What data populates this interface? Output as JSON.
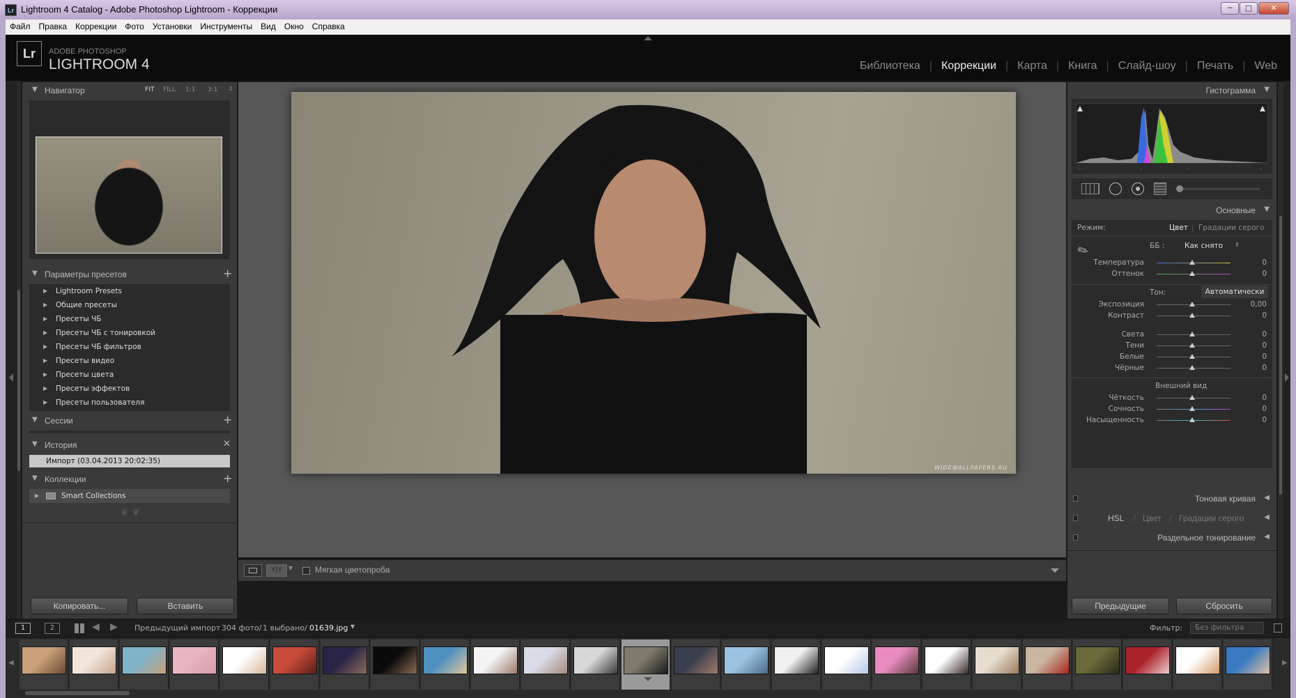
{
  "window": {
    "title": "Lightroom 4 Catalog - Adobe Photoshop Lightroom - Коррекции",
    "app_icon": "Lr",
    "controls": {
      "minimize": "─",
      "maximize": "□",
      "close": "✕"
    }
  },
  "menu": [
    "Файл",
    "Правка",
    "Коррекции",
    "Фото",
    "Установки",
    "Инструменты",
    "Вид",
    "Окно",
    "Справка"
  ],
  "identity": {
    "icon": "Lr",
    "line1": "ADOBE PHOTOSHOP",
    "line2": "LIGHTROOM 4"
  },
  "modules": [
    {
      "label": "Библиотека"
    },
    {
      "label": "Коррекции",
      "active": true
    },
    {
      "label": "Карта"
    },
    {
      "label": "Книга"
    },
    {
      "label": "Слайд-шоу"
    },
    {
      "label": "Печать"
    },
    {
      "label": "Web"
    }
  ],
  "navigator": {
    "title": "Навигатор",
    "zoom": {
      "fit": "FIT",
      "fill": "FILL",
      "one": "1:1",
      "three": "3:1"
    }
  },
  "presets": {
    "title": "Параметры пресетов",
    "items": [
      "Lightroom Presets",
      "Общие пресеты",
      "Пресеты ЧБ",
      "Пресеты ЧБ с тонировкой",
      "Пресеты ЧБ фильтров",
      "Пресеты видео",
      "Пресеты цвета",
      "Пресеты эффектов",
      "Пресеты пользователя"
    ]
  },
  "sessions": {
    "title": "Сессии"
  },
  "history": {
    "title": "История",
    "item": "Импорт (03.04.2013 20:02:35)"
  },
  "collections": {
    "title": "Коллекции",
    "item": "Smart Collections"
  },
  "left_buttons": {
    "copy": "Копировать...",
    "paste": "Вставить"
  },
  "toolbar": {
    "softproof": "Мягкая цветопроба",
    "compare": "Y|Y"
  },
  "watermark": "WIDEWALLPAPERS.RU",
  "histogram": {
    "title": "Гистограмма"
  },
  "basic": {
    "title": "Основные",
    "mode_label": "Режим:",
    "mode_color": "Цвет",
    "mode_gray": "Градации серого",
    "wb_label": "ББ :",
    "wb_value": "Как снято",
    "tone_label": "Тон:",
    "auto": "Автоматически",
    "presence_label": "Внешний вид",
    "sliders_wb": [
      {
        "label": "Температура",
        "value": "0"
      },
      {
        "label": "Оттенок",
        "value": "0"
      }
    ],
    "sliders_tone1": [
      {
        "label": "Экспозиция",
        "value": "0,00"
      },
      {
        "label": "Контраст",
        "value": "0"
      }
    ],
    "sliders_tone2": [
      {
        "label": "Света",
        "value": "0"
      },
      {
        "label": "Тени",
        "value": "0"
      },
      {
        "label": "Белые",
        "value": "0"
      },
      {
        "label": "Чёрные",
        "value": "0"
      }
    ],
    "sliders_presence": [
      {
        "label": "Чёткость",
        "value": "0"
      },
      {
        "label": "Сочность",
        "value": "0"
      },
      {
        "label": "Насыщенность",
        "value": "0"
      }
    ]
  },
  "tone_curve": {
    "title": "Тоновая кривая"
  },
  "hsl": {
    "a": "HSL",
    "b": "Цвет",
    "c": "Градации серого"
  },
  "split_toning": {
    "title": "Раздельное тонирование"
  },
  "right_buttons": {
    "previous": "Предыдущие",
    "reset": "Сбросить"
  },
  "filmstrip_bar": {
    "screen1": "1",
    "screen2": "2",
    "source": "Предыдущий импорт",
    "count": "304 фото/",
    "selected": "1 выбрано/",
    "filename": "01639.jpg",
    "filter_label": "Фильтр:",
    "filter_value": "Без фильтра"
  },
  "colors": {
    "bg": "#1a1a1a",
    "panel": "#3a3a3a",
    "center": "#4d4d4d",
    "accent_active": "#eeeeee"
  },
  "thumbnails": [
    {
      "c1": "#c9a07a",
      "c2": "#6b4a33"
    },
    {
      "c1": "#f2e6dc",
      "c2": "#c8a28e"
    },
    {
      "c1": "#7fb3c9",
      "c2": "#c89f7a"
    },
    {
      "c1": "#e8b6c0",
      "c2": "#d99aa8"
    },
    {
      "c1": "#ffffff",
      "c2": "#d7b79a"
    },
    {
      "c1": "#c84b3a",
      "c2": "#5a1e1a"
    },
    {
      "c1": "#2a2446",
      "c2": "#8b6a5a"
    },
    {
      "c1": "#0a0a0a",
      "c2": "#8a6a55"
    },
    {
      "c1": "#4f90c0",
      "c2": "#e3c79a"
    },
    {
      "c1": "#f4f4f4",
      "c2": "#9a7a6a"
    },
    {
      "c1": "#d9dbe6",
      "c2": "#a58a7a"
    },
    {
      "c1": "#d8d8d8",
      "c2": "#3a3a3a"
    },
    {
      "c1": "#7f7a6c",
      "c2": "#1a1a1a"
    },
    {
      "c1": "#3a3f4e",
      "c2": "#a07a66"
    },
    {
      "c1": "#9bc2e0",
      "c2": "#4a6a8a"
    },
    {
      "c1": "#f0f0f0",
      "c2": "#222222"
    },
    {
      "c1": "#ffffff",
      "c2": "#b8c8e8"
    },
    {
      "c1": "#e98bc0",
      "c2": "#5a3a3a"
    },
    {
      "c1": "#ffffff",
      "c2": "#3a2a2a"
    },
    {
      "c1": "#e6ddd0",
      "c2": "#9a7a5a"
    },
    {
      "c1": "#c9b6a0",
      "c2": "#a8231e"
    },
    {
      "c1": "#6a6a3a",
      "c2": "#2a2a1a"
    },
    {
      "c1": "#a8232a",
      "c2": "#eecccc"
    },
    {
      "c1": "#ffffff",
      "c2": "#d49a6a"
    },
    {
      "c1": "#3a7ac0",
      "c2": "#e0c0a0"
    }
  ]
}
